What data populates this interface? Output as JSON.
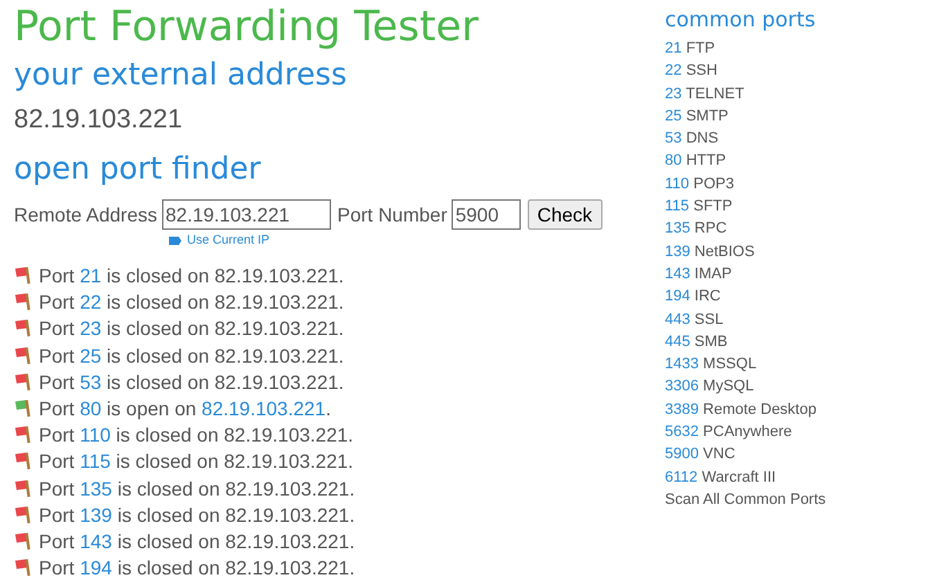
{
  "title": "Port Forwarding Tester",
  "external": {
    "heading": "your external address",
    "address": "82.19.103.221"
  },
  "finder": {
    "heading": "open port finder",
    "address_label": "Remote Address",
    "address_value": "82.19.103.221",
    "port_label": "Port Number",
    "port_value": "5900",
    "button": "Check",
    "use_current": "Use Current IP"
  },
  "results": [
    {
      "prefix": "Port",
      "port": "21",
      "status": "is closed on",
      "address": "82.19.103.221",
      "end": ".",
      "open": false
    },
    {
      "prefix": "Port",
      "port": "22",
      "status": "is closed on",
      "address": "82.19.103.221",
      "end": ".",
      "open": false
    },
    {
      "prefix": "Port",
      "port": "23",
      "status": "is closed on",
      "address": "82.19.103.221",
      "end": ".",
      "open": false
    },
    {
      "prefix": "Port",
      "port": "25",
      "status": "is closed on",
      "address": "82.19.103.221",
      "end": ".",
      "open": false
    },
    {
      "prefix": "Port",
      "port": "53",
      "status": "is closed on",
      "address": "82.19.103.221",
      "end": ".",
      "open": false
    },
    {
      "prefix": "Port",
      "port": "80",
      "status": "is open on",
      "address": "82.19.103.221",
      "end": ".",
      "open": true
    },
    {
      "prefix": "Port",
      "port": "110",
      "status": "is closed on",
      "address": "82.19.103.221",
      "end": ".",
      "open": false
    },
    {
      "prefix": "Port",
      "port": "115",
      "status": "is closed on",
      "address": "82.19.103.221",
      "end": ".",
      "open": false
    },
    {
      "prefix": "Port",
      "port": "135",
      "status": "is closed on",
      "address": "82.19.103.221",
      "end": ".",
      "open": false
    },
    {
      "prefix": "Port",
      "port": "139",
      "status": "is closed on",
      "address": "82.19.103.221",
      "end": ".",
      "open": false
    },
    {
      "prefix": "Port",
      "port": "143",
      "status": "is closed on",
      "address": "82.19.103.221",
      "end": ".",
      "open": false
    },
    {
      "prefix": "Port",
      "port": "194",
      "status": "is closed on",
      "address": "82.19.103.221",
      "end": ".",
      "open": false
    }
  ],
  "common_ports": {
    "heading": "common ports",
    "items": [
      {
        "port": "21",
        "name": "FTP"
      },
      {
        "port": "22",
        "name": "SSH"
      },
      {
        "port": "23",
        "name": "TELNET"
      },
      {
        "port": "25",
        "name": "SMTP"
      },
      {
        "port": "53",
        "name": "DNS"
      },
      {
        "port": "80",
        "name": "HTTP"
      },
      {
        "port": "110",
        "name": "POP3"
      },
      {
        "port": "115",
        "name": "SFTP"
      },
      {
        "port": "135",
        "name": "RPC"
      },
      {
        "port": "139",
        "name": "NetBIOS"
      },
      {
        "port": "143",
        "name": "IMAP"
      },
      {
        "port": "194",
        "name": "IRC"
      },
      {
        "port": "443",
        "name": "SSL"
      },
      {
        "port": "445",
        "name": "SMB"
      },
      {
        "port": "1433",
        "name": "MSSQL"
      },
      {
        "port": "3306",
        "name": "MySQL"
      },
      {
        "port": "3389",
        "name": "Remote Desktop"
      },
      {
        "port": "5632",
        "name": "PCAnywhere"
      },
      {
        "port": "5900",
        "name": "VNC"
      },
      {
        "port": "6112",
        "name": "Warcraft III"
      }
    ],
    "scan_all": "Scan All Common Ports"
  }
}
